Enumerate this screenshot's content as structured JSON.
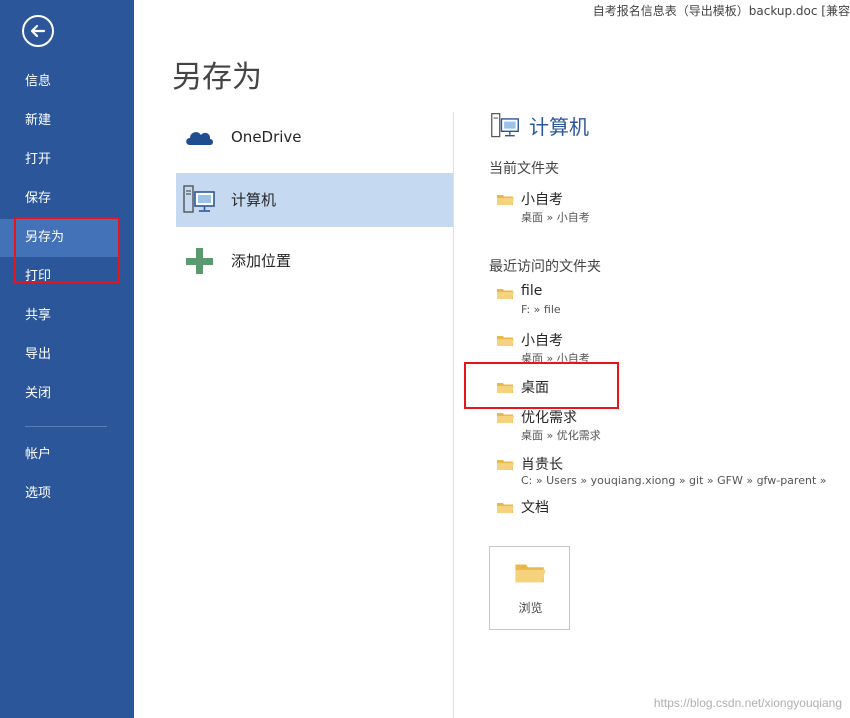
{
  "window": {
    "title": "自考报名信息表（导出模板）backup.doc [兼容"
  },
  "sidebar": {
    "back_icon": "back-arrow-icon",
    "accent": "#2b579a",
    "items": [
      {
        "label": "信息"
      },
      {
        "label": "新建"
      },
      {
        "label": "打开"
      },
      {
        "label": "保存"
      },
      {
        "label": "另存为"
      },
      {
        "label": "打印"
      },
      {
        "label": "共享"
      },
      {
        "label": "导出"
      },
      {
        "label": "关闭"
      },
      {
        "label": "帐户"
      },
      {
        "label": "选项"
      }
    ],
    "active": "另存为"
  },
  "page": {
    "title": "另存为"
  },
  "places": [
    {
      "label": "OneDrive",
      "icon": "cloud-icon"
    },
    {
      "label": "计算机",
      "icon": "computer-icon"
    },
    {
      "label": "添加位置",
      "icon": "plus-icon"
    }
  ],
  "panel": {
    "header": "计算机",
    "current_folder_label": "当前文件夹",
    "current_folder": {
      "name": "小自考",
      "path": "桌面 » 小自考"
    },
    "recent_label": "最近访问的文件夹",
    "recent": [
      {
        "name": "file",
        "path": "F: » file"
      },
      {
        "name": "小自考",
        "path": "桌面 » 小自考"
      },
      {
        "name": "桌面",
        "path": ""
      },
      {
        "name": "优化需求",
        "path": "桌面 » 优化需求"
      },
      {
        "name": "肖贵长",
        "path": "C: » Users » youqiang.xiong » git » GFW » gfw-parent »"
      },
      {
        "name": "文档",
        "path": ""
      }
    ],
    "browse_label": "浏览"
  },
  "watermark": "https://blog.csdn.net/xiongyouqiang"
}
